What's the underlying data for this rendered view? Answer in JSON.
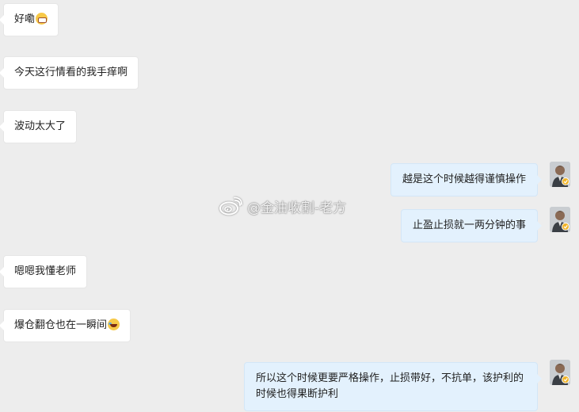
{
  "messages": [
    {
      "side": "left",
      "text": "好嘞",
      "emoji": "grin-icon"
    },
    {
      "side": "left",
      "text": "今天这行情看的我手痒啊"
    },
    {
      "side": "left",
      "text": "波动太大了"
    },
    {
      "side": "right",
      "text": "越是这个时候越得谨慎操作"
    },
    {
      "side": "right",
      "text": "止盈止损就一两分钟的事"
    },
    {
      "side": "left",
      "text": "嗯嗯我懂老师"
    },
    {
      "side": "left",
      "text": "爆仓翻仓也在一瞬间",
      "emoji": "rofl-icon"
    },
    {
      "side": "right",
      "text": "所以这个时候更要严格操作，止损带好，不抗单，该护利的时候也得果断护利"
    }
  ],
  "watermark": {
    "text": "@金油收割-老方",
    "icon": "weibo-icon"
  },
  "colors": {
    "background": "#ededed",
    "left_bubble": "#ffffff",
    "right_bubble": "#e3f1fd",
    "verified": "#f0b429"
  }
}
